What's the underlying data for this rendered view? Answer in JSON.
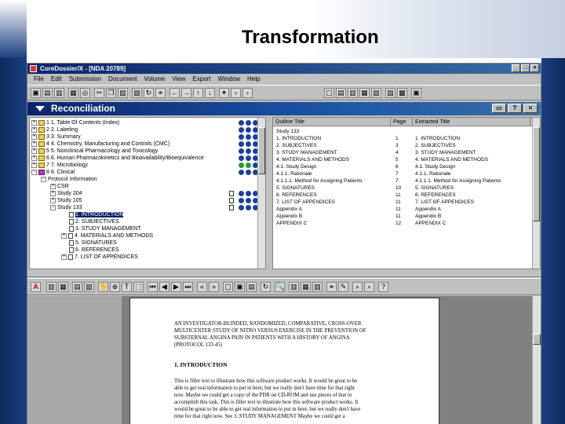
{
  "slide": {
    "title": "Transformation"
  },
  "window": {
    "title": "CoreDossier/X - [NDA 20789]",
    "controls": [
      "_",
      "□",
      "×"
    ]
  },
  "menu": [
    "File",
    "Edit",
    "Submission",
    "Document",
    "Volume",
    "View",
    "Export",
    "Window",
    "Help"
  ],
  "panel": {
    "title": "Reconciliation",
    "buttons": [
      "▭",
      "?",
      "×"
    ]
  },
  "tree": {
    "items": [
      {
        "label": "1 1. Table Of Contents (Index)",
        "level": 0,
        "icon": "folder"
      },
      {
        "label": "2 2. Labeling",
        "level": 0,
        "icon": "folder"
      },
      {
        "label": "3 3. Summary",
        "level": 0,
        "icon": "folder"
      },
      {
        "label": "4 4. Chemistry, Manufacturing and Controls (CMC)",
        "level": 0,
        "icon": "folder"
      },
      {
        "label": "5 5. Nonclinical Pharmacology and Toxicology",
        "level": 0,
        "icon": "folder"
      },
      {
        "label": "6 6. Human Pharmacokinetics and Bioavailability/Bioequivalence",
        "level": 0,
        "icon": "folder"
      },
      {
        "label": "7 7. Microbiology",
        "level": 0,
        "icon": "folder"
      },
      {
        "label": "8 8. Clinical",
        "level": 0,
        "icon": "folder-purple"
      },
      {
        "label": "Protocol Information",
        "level": 1,
        "icon": "expander"
      },
      {
        "label": "CSR",
        "level": 2,
        "icon": "expander"
      },
      {
        "label": "Study 204",
        "level": 2,
        "icon": "expander"
      },
      {
        "label": "Study 105",
        "level": 2,
        "icon": "expander"
      },
      {
        "label": "Study 133",
        "level": 2,
        "icon": "expander"
      },
      {
        "label": "1. INTRODUCTION",
        "level": 3,
        "icon": "page",
        "selected": true
      },
      {
        "label": "2. SUBJECTIVES",
        "level": 3,
        "icon": "page"
      },
      {
        "label": "3. STUDY MANAGEMENT",
        "level": 3,
        "icon": "page"
      },
      {
        "label": "4. MATERIALS AND METHODS",
        "level": 3,
        "icon": "page"
      },
      {
        "label": "5. SIGNATURES",
        "level": 3,
        "icon": "page"
      },
      {
        "label": "6. REFERENCES",
        "level": 3,
        "icon": "page"
      },
      {
        "label": "7. LIST OF APPENDICES",
        "level": 3,
        "icon": "page"
      }
    ]
  },
  "outline": {
    "columns": [
      "Outline Title",
      "Page",
      "Extracted Title"
    ],
    "rows": [
      [
        "Study 133",
        "",
        ""
      ],
      [
        "1. INTRODUCTION",
        "1",
        "1. INTRODUCTION"
      ],
      [
        "2. SUBJECTIVES",
        "3",
        "2. SUBJECTIVES"
      ],
      [
        "3. STUDY MANAGEMENT",
        "4",
        "3. STUDY MANAGEMENT"
      ],
      [
        "4. MATERIALS AND METHODS",
        "5",
        "4. MATERIALS AND METHODS"
      ],
      [
        "4.1. Study Design",
        "6",
        "4.1. Study Design"
      ],
      [
        "4.1.1. Rationale",
        "7",
        "4.1.1. Rationale"
      ],
      [
        "4.1.1.1. Method for Assigning Patients",
        "7",
        "4.1.1.1. Method for Assigning Patients"
      ],
      [
        "5. SIGNATURES",
        "10",
        "5. SIGNATURES"
      ],
      [
        "6. REFERENCES",
        "11",
        "6. REFERENCES"
      ],
      [
        "7. LIST OF APPENDICES",
        "11",
        "7. LIST OF APPENDICES"
      ],
      [
        "Appendix A",
        "11",
        "Appendix A"
      ],
      [
        "Appendix B",
        "11",
        "Appendix B"
      ],
      [
        "APPENDIX C",
        "12",
        "APPENDIX C"
      ]
    ]
  },
  "pdf": {
    "title_lines": [
      "AN INVESTIGATOR-BLINDED, RANDOMIZED, COMPARATIVE, CROSS-OVER",
      "MULTICENTER STUDY OF NITRO VERSUS EXERCISE IN THE PREVENTION OF",
      "SUBSTERNAL ANGINA PAIN IN PATIENTS WITH A HISTORY OF ANGINA",
      "(PROTOCOL 133-45)"
    ],
    "heading": "1.   INTRODUCTION",
    "body_lines": [
      "This is filler text to illustrate how this software product works. It would be great to be",
      "able to get real information to put in here, but we really don't have time for that right",
      "now. Maybe we could get a copy of the PDR on CD-ROM and use pieces of that to",
      "accomplish this task. This is filler text to illustrate how this software product works. It",
      "would be great to be able to get real information to put in here, but we really don't have",
      "time for that right now. See 3.  STUDY MANAGEMENT Maybe we could get a"
    ]
  }
}
